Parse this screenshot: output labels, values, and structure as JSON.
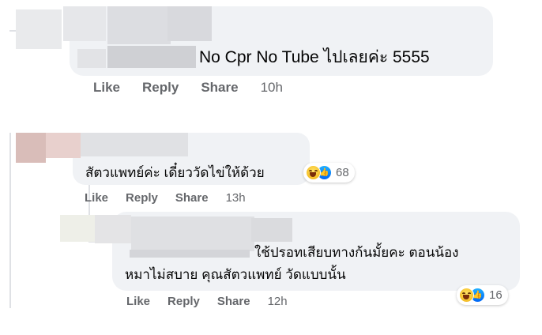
{
  "comments": [
    {
      "text": "No Cpr No Tube ไปเลยค่ะ 5555",
      "actions": {
        "like": "Like",
        "reply": "Reply",
        "share": "Share",
        "time": "10h"
      }
    },
    {
      "text": "สัตวแพทย์ค่ะ เดี๋ยววัดไข่ให้ด้วย",
      "reactions": {
        "icons": [
          "haha-icon",
          "like-icon"
        ],
        "count": "68"
      },
      "actions": {
        "like": "Like",
        "reply": "Reply",
        "share": "Share",
        "time": "13h"
      }
    },
    {
      "text_line1": "ใช้ปรอทเสียบทางก้นมั้ยคะ ตอนน้อง",
      "text_line2": "หมาไม่สบาย คุณสัตวแพทย์ วัดแบบนั้น",
      "reactions": {
        "icons": [
          "haha-icon",
          "like-icon"
        ],
        "count": "16"
      },
      "actions": {
        "like": "Like",
        "reply": "Reply",
        "share": "Share",
        "time": "12h"
      }
    }
  ],
  "colors": {
    "bubble": "#f0f2f5",
    "meta": "#65676b",
    "like_blue": "#1877f2",
    "haha_yellow": "#f7c52f"
  }
}
